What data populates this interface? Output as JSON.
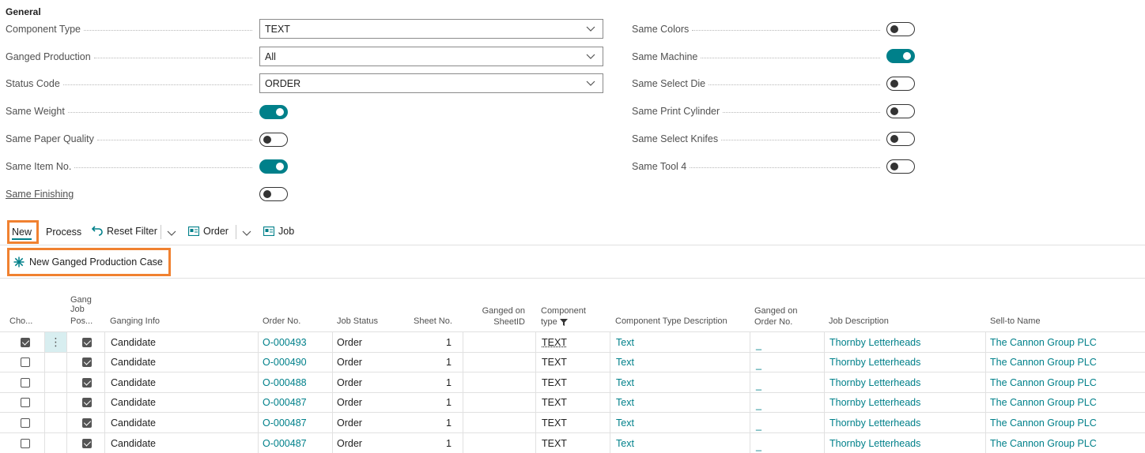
{
  "section": {
    "title": "General"
  },
  "left_fields": [
    {
      "label": "Component Type",
      "value": "TEXT",
      "kind": "select"
    },
    {
      "label": "Ganged Production",
      "value": "All",
      "kind": "select"
    },
    {
      "label": "Status Code",
      "value": "ORDER",
      "kind": "select"
    },
    {
      "label": "Same Weight",
      "kind": "toggle",
      "on": true
    },
    {
      "label": "Same Paper Quality",
      "kind": "toggle",
      "on": false
    },
    {
      "label": "Same Item No.",
      "kind": "toggle",
      "on": true
    },
    {
      "label": "Same Finishing",
      "kind": "toggle",
      "on": false
    }
  ],
  "right_fields": [
    {
      "label": "Same Colors",
      "on": false
    },
    {
      "label": "Same Machine",
      "on": true
    },
    {
      "label": "Same Select Die",
      "on": false
    },
    {
      "label": "Same Print Cylinder",
      "on": false
    },
    {
      "label": "Same Select Knifes",
      "on": false
    },
    {
      "label": "Same Tool 4",
      "on": false
    }
  ],
  "actions": {
    "new": "New",
    "process": "Process",
    "reset_filter": "Reset Filter",
    "order": "Order",
    "job": "Job",
    "new_case": "New Ganged Production Case"
  },
  "highlight_color": "#f08130",
  "accent_color": "#00808a",
  "columns": {
    "cho": "Cho...",
    "gang_job_pos_1": "Gang",
    "gang_job_pos_2": "Job",
    "gang_job_pos_3": "Pos...",
    "ganging_info": "Ganging Info",
    "order_no": "Order No.",
    "job_status": "Job Status",
    "sheet_no": "Sheet No.",
    "ganged_sheet_1": "Ganged on",
    "ganged_sheet_2": "SheetID",
    "component_type_1": "Component",
    "component_type_2": "type",
    "component_type_desc": "Component Type Description",
    "ganged_order_1": "Ganged on",
    "ganged_order_2": "Order No.",
    "job_description": "Job Description",
    "sell_to_name": "Sell-to Name"
  },
  "rows": [
    {
      "chosen": true,
      "gang_pos": true,
      "ganging_info": "Candidate",
      "order_no": "O-000493",
      "job_status": "Order",
      "sheet_no": "1",
      "component_type": "TEXT",
      "component_desc": "Text",
      "ganged_order": "_",
      "job_description": "Thornby Letterheads",
      "sell_to": "The Cannon Group PLC"
    },
    {
      "chosen": false,
      "gang_pos": true,
      "ganging_info": "Candidate",
      "order_no": "O-000490",
      "job_status": "Order",
      "sheet_no": "1",
      "component_type": "TEXT",
      "component_desc": "Text",
      "ganged_order": "_",
      "job_description": "Thornby Letterheads",
      "sell_to": "The Cannon Group PLC"
    },
    {
      "chosen": false,
      "gang_pos": true,
      "ganging_info": "Candidate",
      "order_no": "O-000488",
      "job_status": "Order",
      "sheet_no": "1",
      "component_type": "TEXT",
      "component_desc": "Text",
      "ganged_order": "_",
      "job_description": "Thornby Letterheads",
      "sell_to": "The Cannon Group PLC"
    },
    {
      "chosen": false,
      "gang_pos": true,
      "ganging_info": "Candidate",
      "order_no": "O-000487",
      "job_status": "Order",
      "sheet_no": "1",
      "component_type": "TEXT",
      "component_desc": "Text",
      "ganged_order": "_",
      "job_description": "Thornby Letterheads",
      "sell_to": "The Cannon Group PLC"
    },
    {
      "chosen": false,
      "gang_pos": true,
      "ganging_info": "Candidate",
      "order_no": "O-000487",
      "job_status": "Order",
      "sheet_no": "1",
      "component_type": "TEXT",
      "component_desc": "Text",
      "ganged_order": "_",
      "job_description": "Thornby Letterheads",
      "sell_to": "The Cannon Group PLC"
    },
    {
      "chosen": false,
      "gang_pos": true,
      "ganging_info": "Candidate",
      "order_no": "O-000487",
      "job_status": "Order",
      "sheet_no": "1",
      "component_type": "TEXT",
      "component_desc": "Text",
      "ganged_order": "_",
      "job_description": "Thornby Letterheads",
      "sell_to": "The Cannon Group PLC"
    }
  ]
}
